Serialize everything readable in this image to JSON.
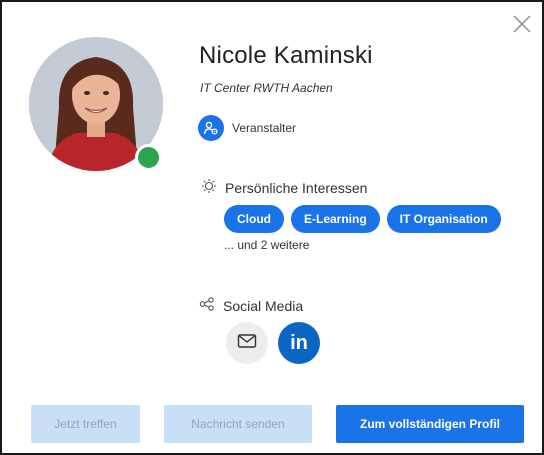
{
  "profile": {
    "name": "Nicole Kaminski",
    "organization": "IT Center RWTH Aachen",
    "role": "Veranstalter",
    "status_color": "#2ea44f"
  },
  "interests": {
    "title": "Persönliche Interessen",
    "chips": [
      "Cloud",
      "E-Learning",
      "IT Organisation"
    ],
    "more": "... und 2 weitere"
  },
  "social": {
    "title": "Social Media",
    "linkedin_label": "in"
  },
  "actions": {
    "meet": "Jetzt treffen",
    "message": "Nachricht senden",
    "profile": "Zum vollständigen Profil"
  },
  "icons": {
    "close": "close-icon",
    "role": "organizer-icon",
    "interests": "lightbulb-icon",
    "social": "share-icon",
    "mail": "mail-icon",
    "linkedin": "linkedin-icon"
  },
  "colors": {
    "accent": "#1a73e8",
    "disabled_bg": "#c9dff7",
    "online": "#2ea44f",
    "linkedin": "#0a66c2"
  }
}
